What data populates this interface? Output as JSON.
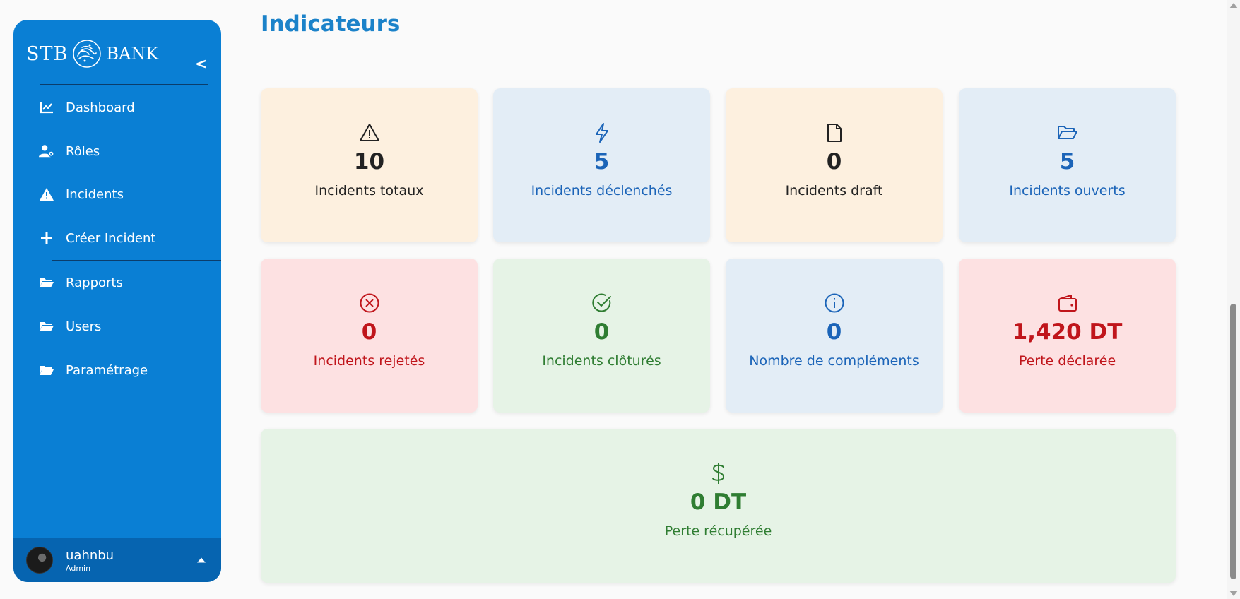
{
  "sidebar": {
    "brand": {
      "left": "STB",
      "right": "BANK"
    },
    "collapse_label": "<",
    "items": [
      {
        "label": "Dashboard",
        "icon": "chart-line-icon"
      },
      {
        "label": "Rôles",
        "icon": "user-gear-icon"
      },
      {
        "label": "Incidents",
        "icon": "warning-icon"
      },
      {
        "label": "Créer Incident",
        "icon": "plus-icon"
      },
      {
        "label": "Rapports",
        "icon": "folder-open-icon"
      },
      {
        "label": "Users",
        "icon": "folder-open-icon"
      },
      {
        "label": "Paramétrage",
        "icon": "folder-open-icon"
      }
    ],
    "user": {
      "name": "uahnbu",
      "role": "Admin"
    }
  },
  "main": {
    "title": "Indicateurs",
    "cards": [
      {
        "value": "10",
        "label": "Incidents totaux",
        "icon": "warning-triangle-icon",
        "tone": "orange",
        "text_color": "#222222"
      },
      {
        "value": "5",
        "label": "Incidents déclenchés",
        "icon": "lightning-icon",
        "tone": "blue",
        "text_color": "#1b64b8"
      },
      {
        "value": "0",
        "label": "Incidents draft",
        "icon": "file-icon",
        "tone": "orange",
        "text_color": "#222222"
      },
      {
        "value": "5",
        "label": "Incidents ouverts",
        "icon": "folder-open-icon",
        "tone": "blue",
        "text_color": "#1b64b8"
      },
      {
        "value": "0",
        "label": "Incidents rejetés",
        "icon": "x-circle-icon",
        "tone": "red",
        "text_color": "#c0151b"
      },
      {
        "value": "0",
        "label": "Incidents clôturés",
        "icon": "check-circle-icon",
        "tone": "green",
        "text_color": "#2f7d32"
      },
      {
        "value": "0",
        "label": "Nombre de compléments",
        "icon": "info-circle-icon",
        "tone": "blue",
        "text_color": "#1b64b8"
      },
      {
        "value": "1,420 DT",
        "label": "Perte déclarée",
        "icon": "wallet-icon",
        "tone": "red",
        "text_color": "#c0151b"
      },
      {
        "value": "0 DT",
        "label": "Perte récupérée",
        "icon": "dollar-icon",
        "tone": "green",
        "text_color": "#2f7d32"
      }
    ]
  },
  "colors": {
    "sidebar_bg": "#0a7fd4",
    "userbar_bg": "#0664b0",
    "title": "#1b82c9",
    "orange_card": "#fdf0df",
    "blue_card": "#e3edf6",
    "red_card": "#fde1e2",
    "green_card": "#e6f3e6"
  }
}
